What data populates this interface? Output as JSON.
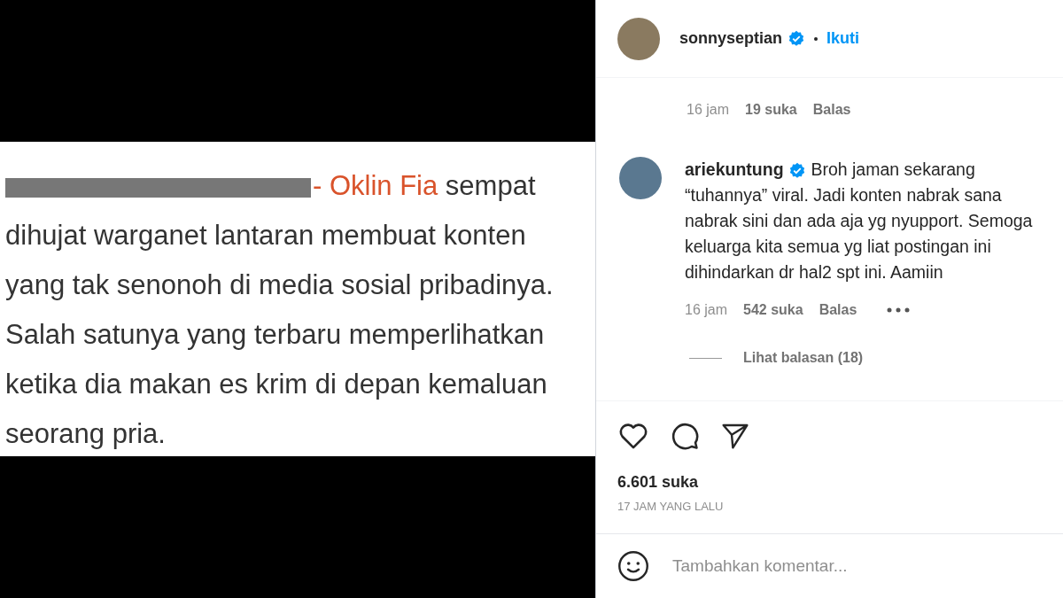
{
  "post_image": {
    "lead": "- Oklin Fia",
    "text": " sempat dihujat warganet lantaran membuat konten yang tak senonoh di media sosial pribadinya. Salah satunya yang terbaru memperlihatkan ketika dia makan es krim di depan kemaluan seorang pria."
  },
  "header": {
    "username": "sonnyseptian",
    "verified": true,
    "follow": "Ikuti"
  },
  "comments": [
    {
      "time": "16 jam",
      "likes": "19 suka",
      "reply": "Balas"
    },
    {
      "username": "ariekuntung",
      "verified": true,
      "text": "Broh jaman sekarang “tuhannya” viral. Jadi konten nabrak sana nabrak sini dan ada aja yg nyupport. Semoga keluarga kita semua yg liat postingan ini dihindarkan dr hal2 spt ini. Aamiin",
      "time": "16 jam",
      "likes": "542 suka",
      "reply": "Balas",
      "more": true,
      "view_replies": "Lihat balasan (18)"
    }
  ],
  "likes": "6.601 suka",
  "posted": "17 JAM YANG LALU",
  "comment_field": {
    "placeholder": "Tambahkan komentar..."
  }
}
